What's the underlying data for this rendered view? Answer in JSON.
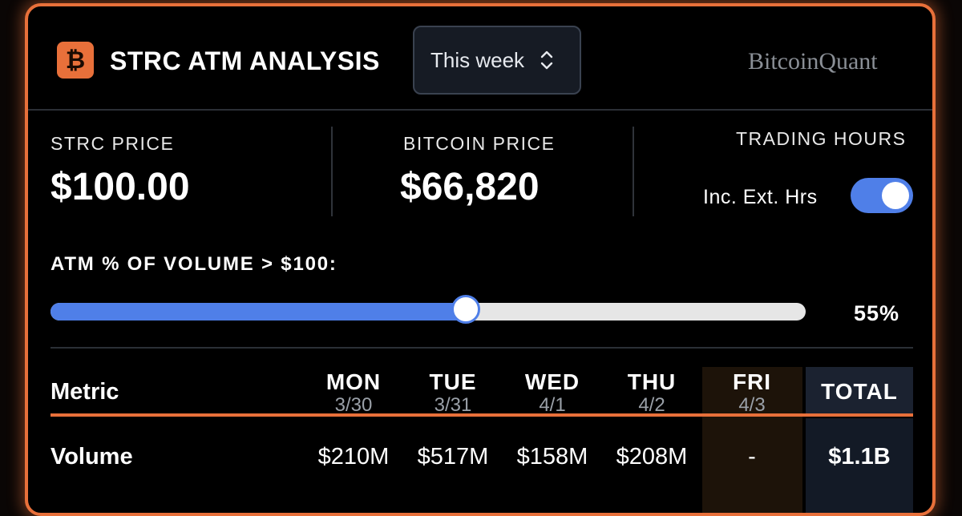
{
  "header": {
    "logo_glyph": "₿",
    "title": "STRC ATM ANALYSIS",
    "period_select": {
      "value": "This week"
    },
    "brand": "BitcoinQuant"
  },
  "stats": {
    "strc_price": {
      "label": "STRC PRICE",
      "value": "$100.00"
    },
    "bitcoin_price": {
      "label": "BITCOIN PRICE",
      "value": "$66,820"
    },
    "trading_hours": {
      "label": "TRADING HOURS",
      "toggle_label": "Inc. Ext. Hrs",
      "enabled": true
    }
  },
  "slider": {
    "label": "ATM % OF VOLUME > $100:",
    "value_text": "55%",
    "fraction": 0.55
  },
  "table": {
    "metric_header": "Metric",
    "days": [
      {
        "name": "MON",
        "date": "3/30"
      },
      {
        "name": "TUE",
        "date": "3/31"
      },
      {
        "name": "WED",
        "date": "4/1"
      },
      {
        "name": "THU",
        "date": "4/2"
      },
      {
        "name": "FRI",
        "date": "4/3"
      }
    ],
    "total_header": "TOTAL",
    "rows": [
      {
        "label": "Volume",
        "values": [
          "$210M",
          "$517M",
          "$158M",
          "$208M",
          "-"
        ],
        "total": "$1.1B"
      }
    ]
  },
  "colors": {
    "accent_orange": "#e8703a",
    "accent_blue": "#4f7fe8",
    "background": "#000000"
  }
}
